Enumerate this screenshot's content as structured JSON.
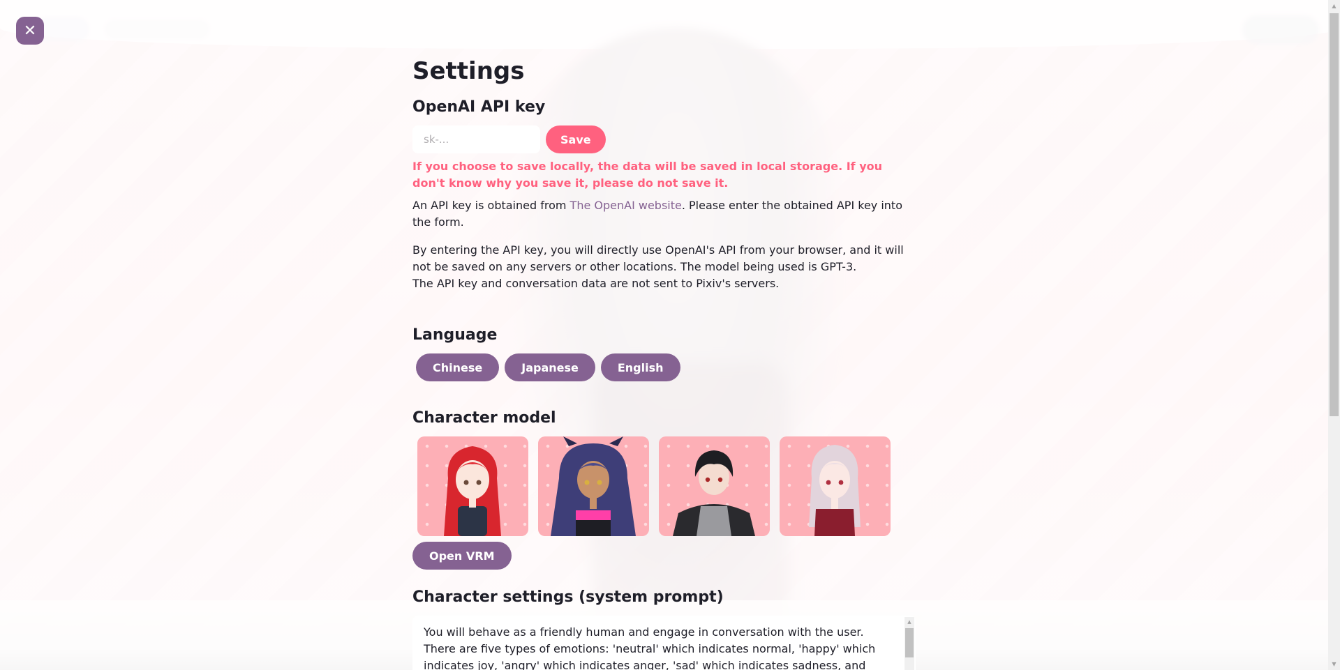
{
  "close_button": {
    "glyph": "✕",
    "icon": "close-icon"
  },
  "title": "Settings",
  "api_key": {
    "heading": "OpenAI API key",
    "input_placeholder": "sk-...",
    "input_value": "",
    "save_label": "Save",
    "warning": "If you choose to save locally, the data will be saved in local storage. If you don't know why you save it, please do not save it.",
    "info_prefix": "An API key is obtained from ",
    "info_link": "The OpenAI website",
    "info_suffix": ". Please enter the obtained API key into the form.",
    "note_line1": "By entering the API key, you will directly use OpenAI's API from your browser, and it will not be saved on any servers or other locations. The model being used is GPT-3.",
    "note_line2": "The API key and conversation data are not sent to Pixiv's servers."
  },
  "language": {
    "heading": "Language",
    "options": [
      "Chinese",
      "Japanese",
      "English"
    ]
  },
  "character_model": {
    "heading": "Character model",
    "models": [
      "avatar-red-hair",
      "avatar-purple-hair",
      "avatar-black-hair",
      "avatar-silver-hair"
    ],
    "open_vrm_label": "Open VRM"
  },
  "character_settings": {
    "heading": "Character settings (system prompt)",
    "prompt_text": "You will behave as a friendly human and engage in conversation with the user. There are five types of emotions: 'neutral' which indicates normal, 'happy' which indicates joy, 'angry' which indicates anger, 'sad' which indicates sadness, and 'relaxed' which"
  },
  "colors": {
    "accent_purple": "#856292",
    "accent_pink": "#ff617f",
    "card_pink": "#fdafb6"
  }
}
